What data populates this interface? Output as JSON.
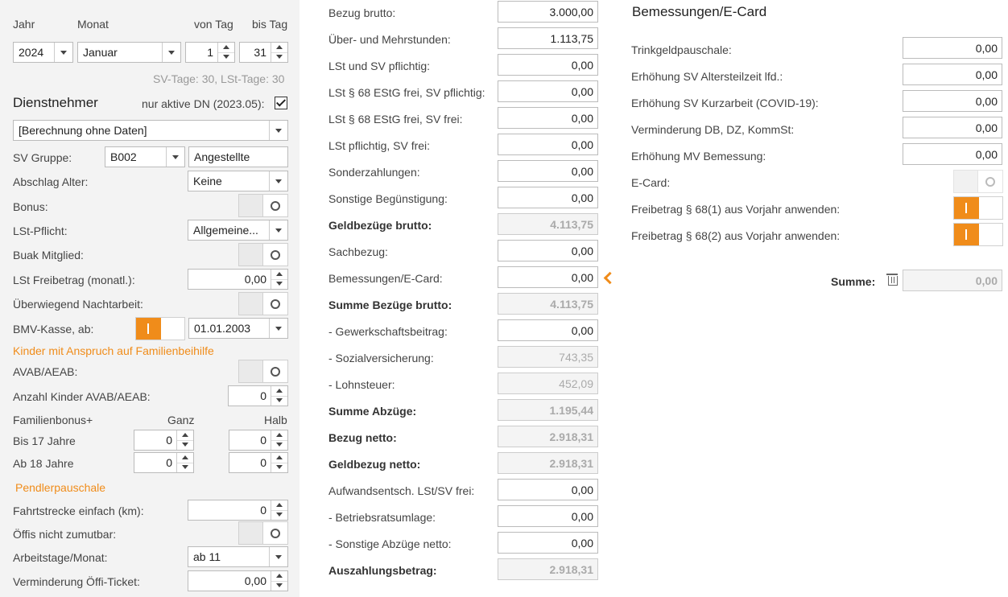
{
  "sidebar": {
    "headers": {
      "jahr": "Jahr",
      "monat": "Monat",
      "von_tag": "von Tag",
      "bis_tag": "bis Tag"
    },
    "year": "2024",
    "month": "Januar",
    "day_from": "1",
    "day_to": "31",
    "tage_info": "SV-Tage: 30,  LSt-Tage: 30",
    "dienstnehmer_title": "Dienstnehmer",
    "nur_aktiv_label": "nur aktive DN (2023.05):",
    "employee_select": "[Berechnung ohne Daten]",
    "sv_gruppe_label": "SV Gruppe:",
    "sv_gruppe_code": "B002",
    "sv_gruppe_name": "Angestellte",
    "abschlag_label": "Abschlag Alter:",
    "abschlag_value": "Keine",
    "bonus_label": "Bonus:",
    "lst_pflicht_label": "LSt-Pflicht:",
    "lst_pflicht_value": "Allgemeine...",
    "buak_label": "Buak Mitglied:",
    "lst_freibetrag_label": "LSt Freibetrag (monatl.):",
    "lst_freibetrag_value": "0,00",
    "nachtarbeit_label": "Überwiegend Nachtarbeit:",
    "bmv_label": "BMV-Kasse, ab:",
    "bmv_date": "01.01.2003",
    "kinder_section": "Kinder mit Anspruch auf Familienbeihilfe",
    "avab_label": "AVAB/AEAB:",
    "anzahl_kinder_label": "Anzahl Kinder AVAB/AEAB:",
    "anzahl_kinder_value": "0",
    "familienbonus_label": "Familienbonus+",
    "ganz_label": "Ganz",
    "halb_label": "Halb",
    "bis17_label": "Bis 17 Jahre",
    "bis17_ganz": "0",
    "bis17_halb": "0",
    "ab18_label": "Ab 18 Jahre",
    "ab18_ganz": "0",
    "ab18_halb": "0",
    "pendler_section": "Pendlerpauschale",
    "fahrtstrecke_label": "Fahrtstrecke einfach (km):",
    "fahrtstrecke_value": "0",
    "oeffis_label": "Öffis nicht zumutbar:",
    "arbeitstage_label": "Arbeitstage/Monat:",
    "arbeitstage_value": "ab 11",
    "verminderung_label": "Verminderung Öffi-Ticket:",
    "verminderung_value": "0,00"
  },
  "middle": {
    "rows": [
      {
        "label": "Bezug brutto:",
        "value": "3.000,00",
        "bold": false,
        "readonly": false
      },
      {
        "label": "Über- und Mehrstunden:",
        "value": "1.113,75",
        "bold": false,
        "readonly": false
      },
      {
        "label": "LSt und SV pflichtig:",
        "value": "0,00",
        "bold": false,
        "readonly": false
      },
      {
        "label": "LSt § 68 EStG frei, SV pflichtig:",
        "value": "0,00",
        "bold": false,
        "readonly": false
      },
      {
        "label": "LSt § 68 EStG frei, SV frei:",
        "value": "0,00",
        "bold": false,
        "readonly": false
      },
      {
        "label": "LSt pflichtig, SV frei:",
        "value": "0,00",
        "bold": false,
        "readonly": false
      },
      {
        "label": "Sonderzahlungen:",
        "value": "0,00",
        "bold": false,
        "readonly": false
      },
      {
        "label": "Sonstige Begünstigung:",
        "value": "0,00",
        "bold": false,
        "readonly": false
      },
      {
        "label": "Geldbezüge brutto:",
        "value": "4.113,75",
        "bold": true,
        "readonly": true
      },
      {
        "label": "Sachbezug:",
        "value": "0,00",
        "bold": false,
        "readonly": false
      },
      {
        "label": "Bemessungen/E-Card:",
        "value": "0,00",
        "bold": false,
        "readonly": false
      },
      {
        "label": "Summe Bezüge brutto:",
        "value": "4.113,75",
        "bold": true,
        "readonly": true
      },
      {
        "label": "- Gewerkschaftsbeitrag:",
        "value": "0,00",
        "bold": false,
        "readonly": false
      },
      {
        "label": "- Sozialversicherung:",
        "value": "743,35",
        "bold": false,
        "readonly": true
      },
      {
        "label": "- Lohnsteuer:",
        "value": "452,09",
        "bold": false,
        "readonly": true
      },
      {
        "label": "Summe Abzüge:",
        "value": "1.195,44",
        "bold": true,
        "readonly": true
      },
      {
        "label": "Bezug netto:",
        "value": "2.918,31",
        "bold": true,
        "readonly": true
      },
      {
        "label": "Geldbezug netto:",
        "value": "2.918,31",
        "bold": true,
        "readonly": true
      },
      {
        "label": "Aufwandsentsch. LSt/SV frei:",
        "value": "0,00",
        "bold": false,
        "readonly": false
      },
      {
        "label": "- Betriebsratsumlage:",
        "value": "0,00",
        "bold": false,
        "readonly": false
      },
      {
        "label": "- Sonstige Abzüge netto:",
        "value": "0,00",
        "bold": false,
        "readonly": false
      },
      {
        "label": "Auszahlungsbetrag:",
        "value": "2.918,31",
        "bold": true,
        "readonly": true
      }
    ]
  },
  "right": {
    "title": "Bemessungen/E-Card",
    "rows": [
      {
        "label": "Trinkgeldpauschale:",
        "value": "0,00"
      },
      {
        "label": "Erhöhung SV Altersteilzeit lfd.:",
        "value": "0,00"
      },
      {
        "label": "Erhöhung SV Kurzarbeit (COVID-19):",
        "value": "0,00"
      },
      {
        "label": "Verminderung DB, DZ, KommSt:",
        "value": "0,00"
      },
      {
        "label": "Erhöhung MV Bemessung:",
        "value": "0,00"
      }
    ],
    "ecard_label": "E-Card:",
    "freibetrag1_label": "Freibetrag § 68(1) aus Vorjahr anwenden:",
    "freibetrag2_label": "Freibetrag § 68(2) aus Vorjahr anwenden:",
    "summe_label": "Summe:",
    "summe_value": "0,00"
  },
  "colors": {
    "accent": "#f08c1a",
    "sidebar_bg": "#f3f3f3"
  }
}
